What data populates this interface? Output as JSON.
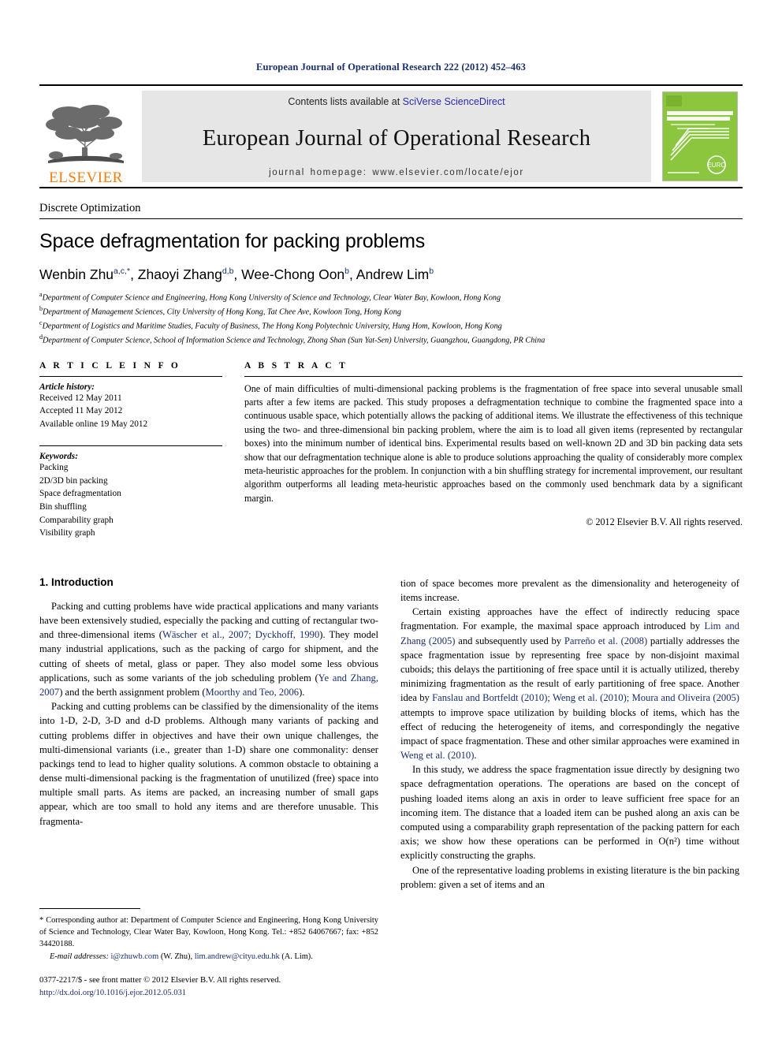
{
  "running_head": "European Journal of Operational Research 222 (2012) 452–463",
  "masthead": {
    "publisher_name": "ELSEVIER",
    "contents_prefix": "Contents lists available at ",
    "contents_link": "SciVerse ScienceDirect",
    "journal_title": "European Journal of Operational Research",
    "homepage": "journal homepage: www.elsevier.com/locate/ejor",
    "cover": {
      "line1": "EUROPEAN JOURNAL OF",
      "line2": "OPERATIONAL RESEARCH",
      "editor_line": "Editors:",
      "footer": "www.elsevier.com/locate/ejor",
      "logo_text": "EURO",
      "bg_color": "#8cc63f"
    }
  },
  "section_label": "Discrete Optimization",
  "title": "Space defragmentation for packing problems",
  "authors": [
    {
      "name": "Wenbin Zhu",
      "sup": "a,c,*"
    },
    {
      "name": "Zhaoyi Zhang",
      "sup": "d,b"
    },
    {
      "name": "Wee-Chong Oon",
      "sup": "b"
    },
    {
      "name": "Andrew Lim",
      "sup": "b"
    }
  ],
  "affiliations": [
    {
      "mark": "a",
      "text": "Department of Computer Science and Engineering, Hong Kong University of Science and Technology, Clear Water Bay, Kowloon, Hong Kong"
    },
    {
      "mark": "b",
      "text": "Department of Management Sciences, City University of Hong Kong, Tat Chee Ave, Kowloon Tong, Hong Kong"
    },
    {
      "mark": "c",
      "text": "Department of Logistics and Maritime Studies, Faculty of Business, The Hong Kong Polytechnic University, Hung Hom, Kowloon, Hong Kong"
    },
    {
      "mark": "d",
      "text": "Department of Computer Science, School of Information Science and Technology, Zhong Shan (Sun Yat-Sen) University, Guangzhou, Guangdong, PR China"
    }
  ],
  "article_info": {
    "heading": "A R T I C L E  I N F O",
    "history_label": "Article history:",
    "history": [
      "Received 12 May 2011",
      "Accepted 11 May 2012",
      "Available online 19 May 2012"
    ],
    "keywords_label": "Keywords:",
    "keywords": [
      "Packing",
      "2D/3D bin packing",
      "Space defragmentation",
      "Bin shuffling",
      "Comparability graph",
      "Visibility graph"
    ]
  },
  "abstract": {
    "heading": "A B S T R A C T",
    "text": "One of main difficulties of multi-dimensional packing problems is the fragmentation of free space into several unusable small parts after a few items are packed. This study proposes a defragmentation technique to combine the fragmented space into a continuous usable space, which potentially allows the packing of additional items. We illustrate the effectiveness of this technique using the two- and three-dimensional bin packing problem, where the aim is to load all given items (represented by rectangular boxes) into the minimum number of identical bins. Experimental results based on well-known 2D and 3D bin packing data sets show that our defragmentation technique alone is able to produce solutions approaching the quality of considerably more complex meta-heuristic approaches for the problem. In conjunction with a bin shuffling strategy for incremental improvement, our resultant algorithm outperforms all leading meta-heuristic approaches based on the commonly used benchmark data by a significant margin.",
    "copyright": "© 2012 Elsevier B.V. All rights reserved."
  },
  "introduction": {
    "heading": "1. Introduction",
    "left_paragraphs": [
      {
        "parts": [
          {
            "t": "Packing and cutting problems have wide practical applications and many variants have been extensively studied, especially the packing and cutting of rectangular two- and three-dimensional items ("
          },
          {
            "t": "Wäscher et al., 2007; Dyckhoff, 1990",
            "cite": true
          },
          {
            "t": "). They model many industrial applications, such as the packing of cargo for shipment, and the cutting of sheets of metal, glass or paper. They also model some less obvious applications, such as some variants of the job scheduling problem ("
          },
          {
            "t": "Ye and Zhang, 2007",
            "cite": true
          },
          {
            "t": ") and the berth assignment problem ("
          },
          {
            "t": "Moorthy and Teo, 2006",
            "cite": true
          },
          {
            "t": ")."
          }
        ]
      },
      {
        "parts": [
          {
            "t": "Packing and cutting problems can be classified by the dimensionality of the items into 1-D, 2-D, 3-D and d-D problems. Although many variants of packing and cutting problems differ in objectives and have their own unique challenges, the multi-dimensional variants (i.e., greater than 1-D) share one commonality: denser packings tend to lead to higher quality solutions. A common obstacle to obtaining a dense multi-dimensional packing is the fragmentation of unutilized (free) space into multiple small parts. As items are packed, an increasing number of small gaps appear, which are too small to hold any items and are therefore unusable. This fragmenta-"
          }
        ]
      }
    ],
    "right_paragraphs": [
      {
        "indent": false,
        "parts": [
          {
            "t": "tion of space becomes more prevalent as the dimensionality and heterogeneity of items increase."
          }
        ]
      },
      {
        "indent": true,
        "parts": [
          {
            "t": "Certain existing approaches have the effect of indirectly reducing space fragmentation. For example, the maximal space approach introduced by "
          },
          {
            "t": "Lim and Zhang (2005)",
            "cite": true
          },
          {
            "t": " and subsequently used by "
          },
          {
            "t": "Parreño et al. (2008)",
            "cite": true
          },
          {
            "t": " partially addresses the space fragmentation issue by representing free space by non-disjoint maximal cuboids; this delays the partitioning of free space until it is actually utilized, thereby minimizing fragmentation as the result of early partitioning of free space. Another idea by "
          },
          {
            "t": "Fanslau and Bortfeldt (2010); Weng et al. (2010); Moura and Oliveira (2005)",
            "cite": true
          },
          {
            "t": " attempts to improve space utilization by building blocks of items, which has the effect of reducing the heterogeneity of items, and correspondingly the negative impact of space fragmentation. These and other similar approaches were examined in "
          },
          {
            "t": "Weng et al. (2010)",
            "cite": true
          },
          {
            "t": "."
          }
        ]
      },
      {
        "indent": true,
        "parts": [
          {
            "t": "In this study, we address the space fragmentation issue directly by designing two space defragmentation operations. The operations are based on the concept of pushing loaded items along an axis in order to leave sufficient free space for an incoming item. The distance that a loaded item can be pushed along an axis can be computed using a comparability graph representation of the packing pattern for each axis; we show how these operations can be performed in O(n²) time without explicitly constructing the graphs."
          }
        ]
      },
      {
        "indent": true,
        "parts": [
          {
            "t": "One of the representative loading problems in existing literature is the bin packing problem: given a set of items and an"
          }
        ]
      }
    ]
  },
  "footnote": {
    "corresponding": "* Corresponding author at: Department of Computer Science and Engineering, Hong Kong University of Science and Technology, Clear Water Bay, Kowloon, Hong Kong. Tel.: +852 64067667; fax: +852 34420188.",
    "email_label": "E-mail addresses:",
    "email1": "i@zhuwb.com",
    "email1_owner": "(W. Zhu),",
    "email2": "lim.andrew@cityu.edu.hk",
    "email2_owner": "(A. Lim)."
  },
  "bottom": {
    "issn_line": "0377-2217/$ - see front matter © 2012 Elsevier B.V. All rights reserved.",
    "doi": "http://dx.doi.org/10.1016/j.ejor.2012.05.031"
  }
}
